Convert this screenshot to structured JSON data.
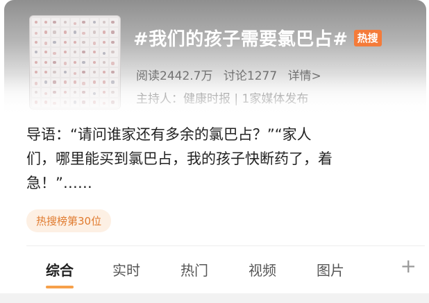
{
  "topic": {
    "title": "#我们的孩子需要氯巴占#",
    "hot_badge": "热搜",
    "reads": "阅读2442.7万",
    "discussions": "讨论1277",
    "details": "详情>",
    "host": "主持人：健康时报 | 1家媒体发布"
  },
  "intro": {
    "line1": "导语：“请问谁家还有多余的氯巴占？”“家人",
    "line2": "们，哪里能买到氯巴占，我的孩子快断药了，着",
    "line3": "急！”……"
  },
  "rank_badge": "热搜榜第30位",
  "tabs": [
    {
      "label": "综合"
    },
    {
      "label": "实时"
    },
    {
      "label": "热门"
    },
    {
      "label": "视频"
    },
    {
      "label": "图片"
    }
  ],
  "add_tab_glyph": "+",
  "colors": {
    "accent": "#f6a04a",
    "hot_badge": "#f47b3a",
    "rank_text": "#e07a2e"
  }
}
